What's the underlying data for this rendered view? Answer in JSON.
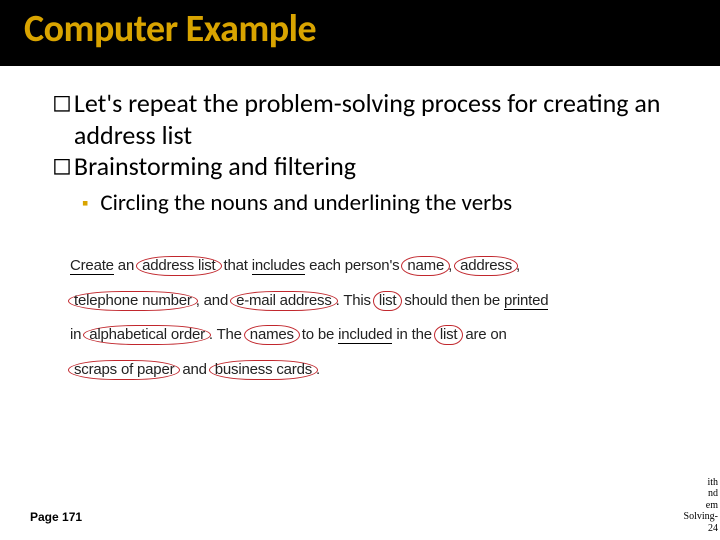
{
  "title": "Computer Example",
  "bullets": {
    "b1": "Let's repeat the problem-solving process for creating an address list",
    "b2": "Brainstorming and filtering",
    "b2_1": "Circling the nouns and underlining the verbs"
  },
  "figure": {
    "w_create": "Create",
    "t1": " an ",
    "w_addresslist": "address list",
    "t2": " that ",
    "w_includes": "includes",
    "t3": " each person's ",
    "w_name": "name",
    "w_address": "address",
    "w_telnum": "telephone number",
    "t4": ", and ",
    "w_email": "e-mail address",
    "t5": ". This ",
    "w_list": "list",
    "t6": " should then be ",
    "w_printed": "printed",
    "t7": " in ",
    "w_alpha": "alphabetical order",
    "t8": ". The ",
    "w_names": "names",
    "t9": " to be ",
    "w_included": "included",
    "t10": " in the ",
    "w_list2": "list",
    "t11": " are on ",
    "w_scraps": "scraps of paper",
    "t12": " and ",
    "w_cards": "business cards",
    "t13": "."
  },
  "page_ref": "Page 171",
  "fragment": {
    "l1": "ith",
    "l2": "nd",
    "l3": "em",
    "l4": "Solving-",
    "l5": "24"
  },
  "markers": {
    "box": "◻",
    "square": "▪"
  }
}
